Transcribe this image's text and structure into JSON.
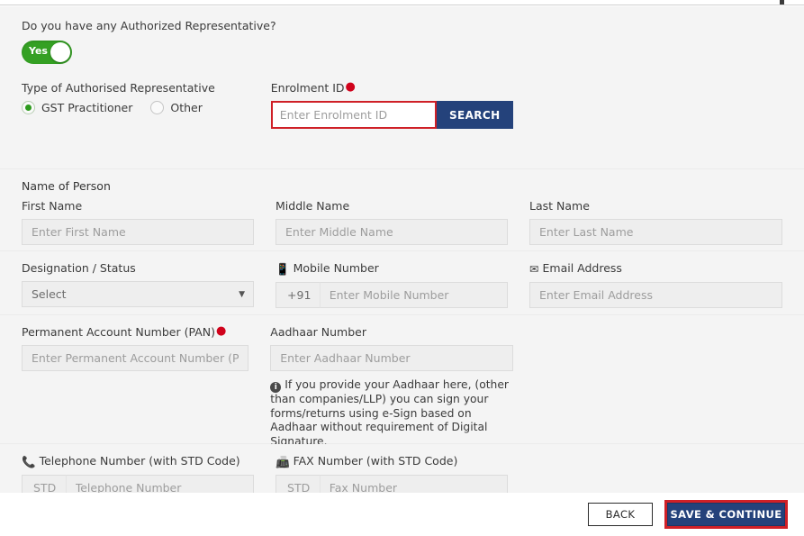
{
  "form": {
    "authorized_rep_question": "Do you have any Authorized Representative?",
    "toggle": {
      "label": "Yes",
      "state": "on"
    },
    "type_label": "Type of Authorised Representative",
    "type_options": [
      {
        "label": "GST Practitioner",
        "selected": true
      },
      {
        "label": "Other",
        "selected": false
      }
    ],
    "enrolment": {
      "label": "Enrolment ID",
      "required": true,
      "placeholder": "Enter Enrolment ID",
      "value": "",
      "search_button": "SEARCH"
    },
    "name_of_person_label": "Name of Person",
    "first_name": {
      "label": "First Name",
      "placeholder": "Enter First Name",
      "value": ""
    },
    "middle_name": {
      "label": "Middle Name",
      "placeholder": "Enter Middle Name",
      "value": ""
    },
    "last_name": {
      "label": "Last Name",
      "placeholder": "Enter Last Name",
      "value": ""
    },
    "designation": {
      "label": "Designation / Status",
      "selected": "Select"
    },
    "mobile": {
      "label": "Mobile Number",
      "prefix": "+91",
      "placeholder": "Enter Mobile Number",
      "value": "",
      "icon": "mobile-phone-icon"
    },
    "email": {
      "label": "Email Address",
      "placeholder": "Enter Email Address",
      "value": "",
      "icon": "envelope-icon"
    },
    "pan": {
      "label": "Permanent Account Number (PAN)",
      "required": true,
      "placeholder": "Enter Permanent Account Number (PAN)",
      "value": ""
    },
    "aadhaar": {
      "label": "Aadhaar Number",
      "placeholder": "Enter Aadhaar Number",
      "value": ""
    },
    "aadhaar_note": "If you provide your Aadhaar here, (other than companies/LLP) you can sign your forms/returns using e-Sign based on Aadhaar without requirement of Digital Signature.",
    "telephone": {
      "label": "Telephone Number (with STD Code)",
      "std_placeholder": "STD",
      "placeholder": "Telephone Number",
      "value": "",
      "icon": "telephone-receiver-icon"
    },
    "fax": {
      "label": "FAX Number (with STD Code)",
      "std_placeholder": "STD",
      "placeholder": "Fax Number",
      "value": "",
      "icon": "fax-machine-icon"
    }
  },
  "footer": {
    "back_label": "BACK",
    "save_label": "SAVE & CONTINUE"
  },
  "colors": {
    "accent_blue": "#24427b",
    "highlight_red": "#cf2027",
    "toggle_green": "#34a023",
    "required_red": "#d0021b",
    "section_bg": "#f4f4f4"
  }
}
